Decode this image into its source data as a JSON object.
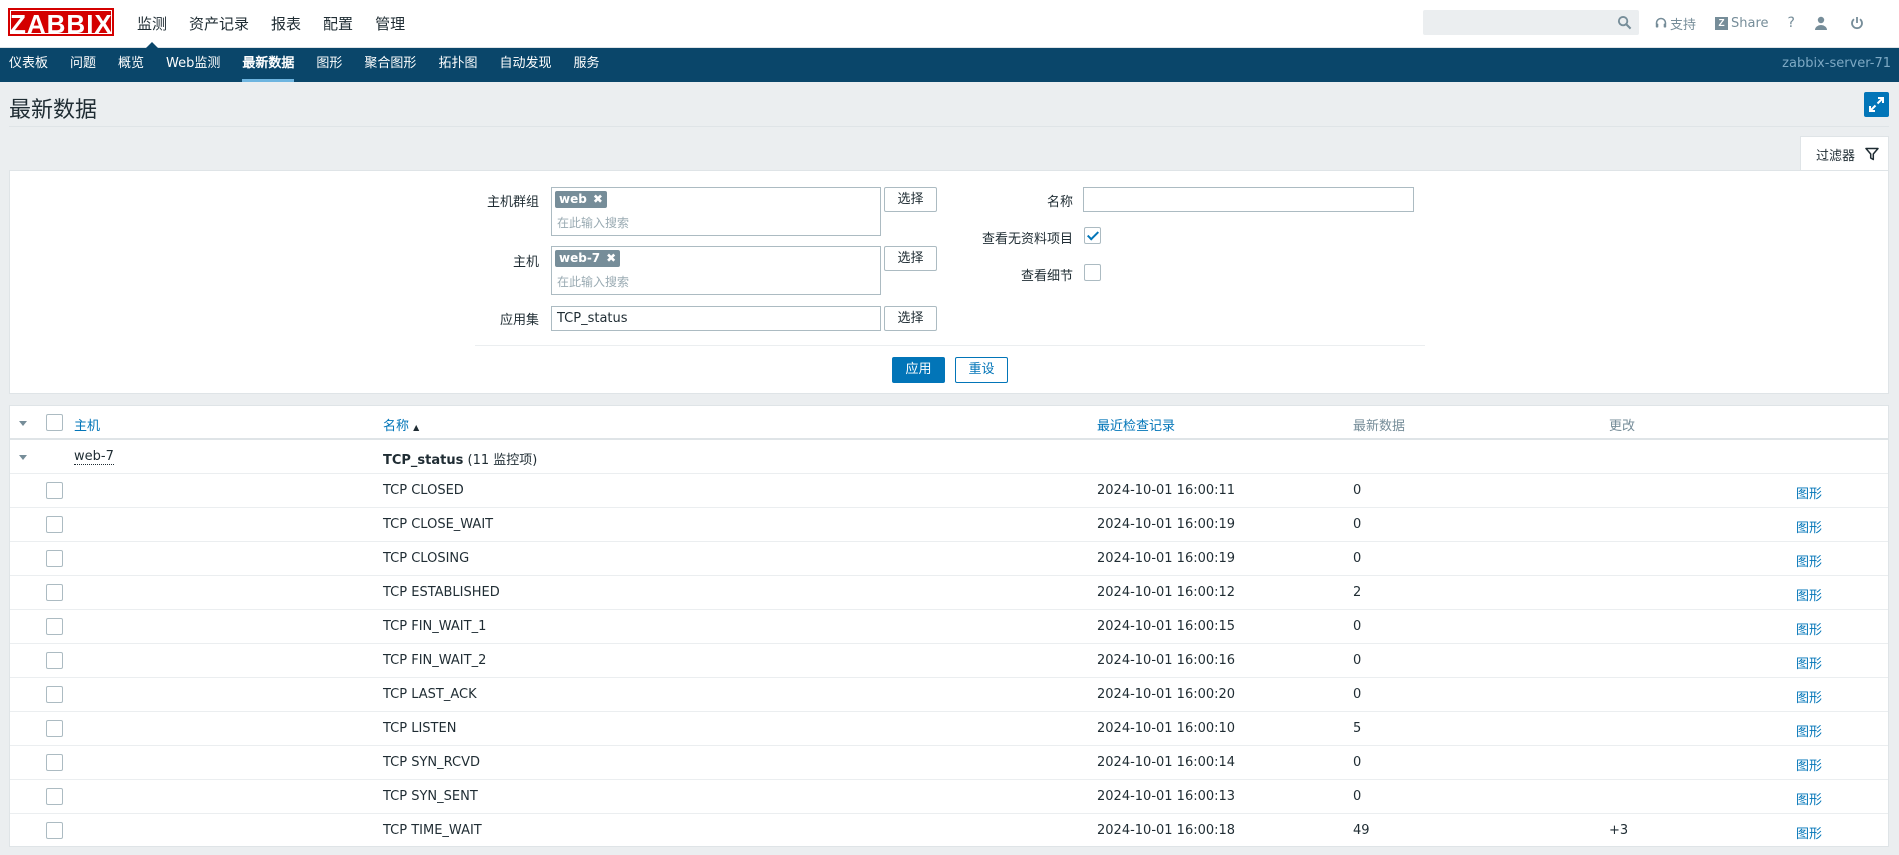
{
  "logo": "ZABBIX",
  "main_menu": [
    "监测",
    "资产记录",
    "报表",
    "配置",
    "管理"
  ],
  "top_links": {
    "support": "支持",
    "share": "Share",
    "help": "?"
  },
  "sub_menu": [
    "仪表板",
    "问题",
    "概览",
    "Web监测",
    "最新数据",
    "图形",
    "聚合图形",
    "拓扑图",
    "自动发现",
    "服务"
  ],
  "server_name": "zabbix-server-71",
  "page_title": "最新数据",
  "filter": {
    "tab_label": "过滤器",
    "hostgroup_label": "主机群组",
    "hostgroup_tag": "web",
    "host_label": "主机",
    "host_tag": "web-7",
    "search_placeholder": "在此输入搜索",
    "application_label": "应用集",
    "application_value": "TCP_status",
    "select_label": "选择",
    "name_label": "名称",
    "name_value": "",
    "show_without_data_label": "查看无资料项目",
    "show_without_data": true,
    "show_details_label": "查看细节",
    "show_details": false,
    "apply_label": "应用",
    "reset_label": "重设"
  },
  "table": {
    "columns": {
      "host": "主机",
      "name": "名称",
      "name_sort": "▲",
      "lastcheck": "最近检查记录",
      "lastvalue": "最新数据",
      "change": "更改"
    },
    "group": {
      "host": "web-7",
      "app": "TCP_status",
      "count": "(11 监控项)"
    },
    "graph_label": "图形",
    "rows": [
      {
        "name": "TCP CLOSED",
        "time": "2024-10-01 16:00:11",
        "value": "0",
        "change": ""
      },
      {
        "name": "TCP CLOSE_WAIT",
        "time": "2024-10-01 16:00:19",
        "value": "0",
        "change": ""
      },
      {
        "name": "TCP CLOSING",
        "time": "2024-10-01 16:00:19",
        "value": "0",
        "change": ""
      },
      {
        "name": "TCP ESTABLISHED",
        "time": "2024-10-01 16:00:12",
        "value": "2",
        "change": ""
      },
      {
        "name": "TCP FIN_WAIT_1",
        "time": "2024-10-01 16:00:15",
        "value": "0",
        "change": ""
      },
      {
        "name": "TCP FIN_WAIT_2",
        "time": "2024-10-01 16:00:16",
        "value": "0",
        "change": ""
      },
      {
        "name": "TCP LAST_ACK",
        "time": "2024-10-01 16:00:20",
        "value": "0",
        "change": ""
      },
      {
        "name": "TCP LISTEN",
        "time": "2024-10-01 16:00:10",
        "value": "5",
        "change": ""
      },
      {
        "name": "TCP SYN_RCVD",
        "time": "2024-10-01 16:00:14",
        "value": "0",
        "change": ""
      },
      {
        "name": "TCP SYN_SENT",
        "time": "2024-10-01 16:00:13",
        "value": "0",
        "change": ""
      },
      {
        "name": "TCP TIME_WAIT",
        "time": "2024-10-01 16:00:18",
        "value": "49",
        "change": "+3"
      }
    ]
  }
}
